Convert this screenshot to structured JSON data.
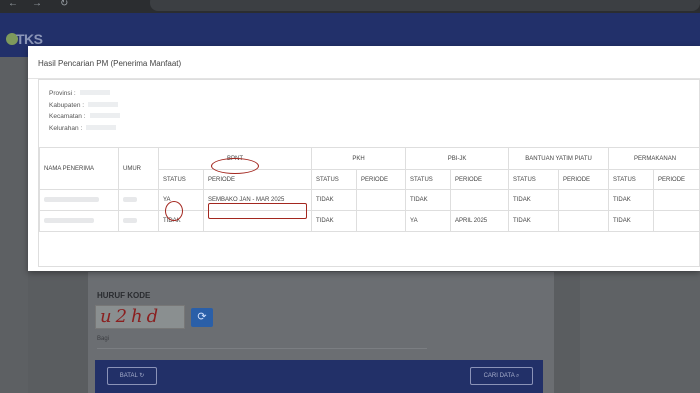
{
  "app": {
    "logo_text": "TKS"
  },
  "modal": {
    "title": "Hasil Pencarian PM (Penerima Manfaat)",
    "info": [
      {
        "label": "Provinsi :"
      },
      {
        "label": "Kabupaten :"
      },
      {
        "label": "Kecamatan :"
      },
      {
        "label": "Kelurahan :"
      }
    ],
    "table": {
      "headers": {
        "name": "NAMA PENERIMA",
        "age": "UMUR",
        "programs": [
          "BPNT",
          "PKH",
          "PBI-JK",
          "BANTUAN YATIM PIATU",
          "PERMAKANAN"
        ],
        "status": "STATUS",
        "period": "PERIODE"
      },
      "rows": [
        {
          "cells": [
            "YA",
            "SEMBAKO JAN - MAR 2025",
            "TIDAK",
            "",
            "TIDAK",
            "",
            "TIDAK",
            "",
            "TIDAK",
            ""
          ]
        },
        {
          "cells": [
            "TIDAK",
            "",
            "TIDAK",
            "",
            "YA",
            "APRIL 2025",
            "TIDAK",
            "",
            "TIDAK",
            ""
          ]
        }
      ]
    }
  },
  "captcha": {
    "title": "HURUF KODE",
    "image_text": "u2hd",
    "input_label": "Bagi",
    "refresh_icon": "refresh-icon"
  },
  "actions": {
    "batal_label": "BATAL",
    "cari_label": "CARI DATA",
    "batal_icon": "refresh-icon",
    "cari_icon": "search-icon"
  },
  "colors": {
    "header": "#22306a",
    "highlight": "#a3271f",
    "modal_bg": "#ffffff"
  }
}
